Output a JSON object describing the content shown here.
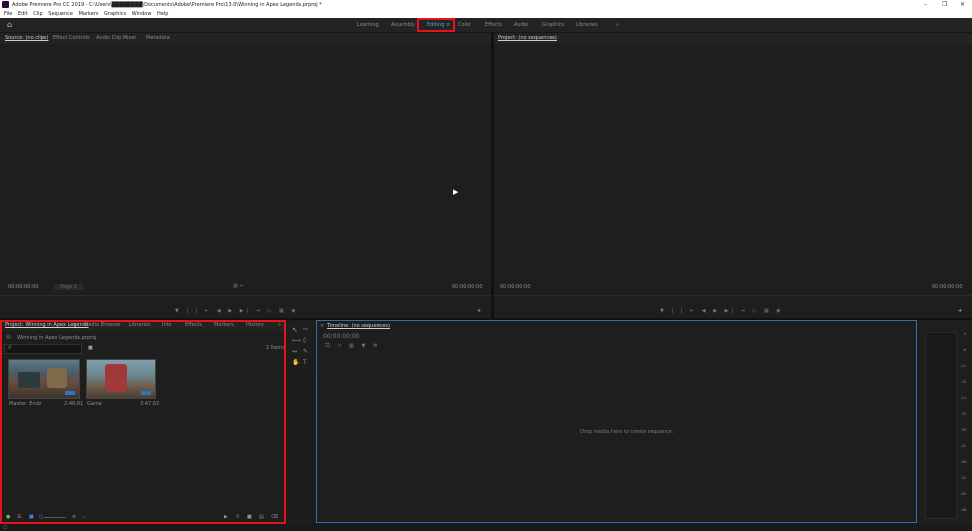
{
  "window": {
    "title": "Adobe Premiere Pro CC 2019 - C:\\Users\\████████\\Documents\\Adobe\\Premiere Pro\\13.0\\Winning in Apex Legends.prproj *",
    "minimize": "–",
    "maximize": "❐",
    "close": "✕"
  },
  "menu": [
    "File",
    "Edit",
    "Clip",
    "Sequence",
    "Markers",
    "Graphics",
    "Window",
    "Help"
  ],
  "workspaces": {
    "items": [
      "Learning",
      "Assembly",
      "Editing",
      "Color",
      "Effects",
      "Audio",
      "Graphics",
      "Libraries"
    ],
    "active": "Editing",
    "more": "»"
  },
  "source": {
    "tabs": [
      "Source: (no clips)",
      "Effect Controls",
      "Audio Clip Mixer",
      "Metadata"
    ],
    "timecode_left": "00;00;00;00",
    "fit": "Page 1",
    "timecode_right": "00;00;00;00"
  },
  "program": {
    "tab": "Project: (no sequences)",
    "timecode_left": "00;00;00;00",
    "timecode_right": "00;00;00;00"
  },
  "project": {
    "tabs": [
      "Project: Winning in Apex Legends",
      "Media Browser",
      "Libraries",
      "Info",
      "Effects",
      "Markers",
      "History"
    ],
    "file": "Winning in Apex Legends.prproj",
    "item_count": "2 Items",
    "items": [
      {
        "name": "Master: Endz",
        "duration": "2:46:01"
      },
      {
        "name": "Game",
        "duration": "3:47:02"
      }
    ]
  },
  "timeline": {
    "tab": "Timeline: (no sequences)",
    "timecode": "00;00;00;00",
    "empty_message": "Drop media here to create sequence."
  },
  "audio_meter": {
    "ticks": [
      "0",
      "-6",
      "-12",
      "-18",
      "-24",
      "-30",
      "-36",
      "-42",
      "-48",
      "-54",
      "-60",
      "dB"
    ]
  },
  "colors": {
    "accent": "#5a9fe0",
    "highlight": "#e3141c"
  }
}
